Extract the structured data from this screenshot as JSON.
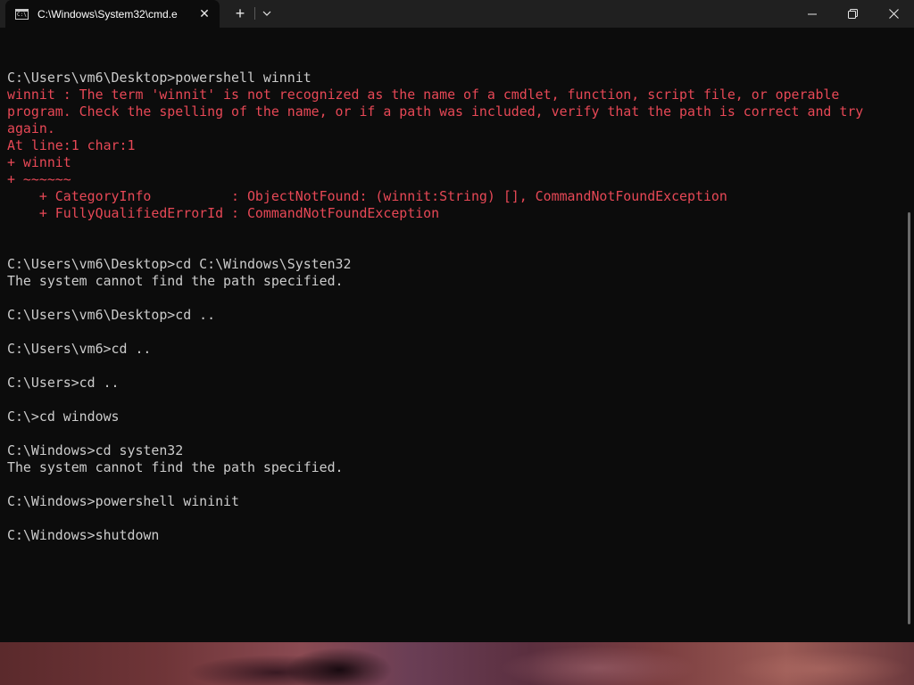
{
  "window": {
    "tab_title": "C:\\Windows\\System32\\cmd.e",
    "tab_icon_label": "C:\\",
    "new_tab_label": "+",
    "close_tab_label": "✕"
  },
  "icons": {
    "tab_icon": "terminal-icon",
    "close_tab": "close-icon",
    "new_tab": "plus-icon",
    "dropdown": "chevron-down-icon",
    "minimize": "minimize-icon",
    "maximize": "restore-icon",
    "close_window": "close-icon"
  },
  "colors": {
    "background": "#0c0c0c",
    "titlebar": "#202020",
    "text": "#cccccc",
    "error": "#e74856"
  },
  "terminal": {
    "lines": [
      {
        "text": "C:\\Users\\vm6\\Desktop>powershell winnit",
        "kind": "normal"
      },
      {
        "text": "winnit : The term 'winnit' is not recognized as the name of a cmdlet, function, script file, or operable",
        "kind": "error"
      },
      {
        "text": "program. Check the spelling of the name, or if a path was included, verify that the path is correct and try",
        "kind": "error"
      },
      {
        "text": "again.",
        "kind": "error"
      },
      {
        "text": "At line:1 char:1",
        "kind": "error"
      },
      {
        "text": "+ winnit",
        "kind": "error"
      },
      {
        "text": "+ ~~~~~~",
        "kind": "error"
      },
      {
        "text": "    + CategoryInfo          : ObjectNotFound: (winnit:String) [], CommandNotFoundException",
        "kind": "error"
      },
      {
        "text": "    + FullyQualifiedErrorId : CommandNotFoundException",
        "kind": "error"
      },
      {
        "text": "",
        "kind": "normal"
      },
      {
        "text": "",
        "kind": "normal"
      },
      {
        "text": "C:\\Users\\vm6\\Desktop>cd C:\\Windows\\Systen32",
        "kind": "normal"
      },
      {
        "text": "The system cannot find the path specified.",
        "kind": "normal"
      },
      {
        "text": "",
        "kind": "normal"
      },
      {
        "text": "C:\\Users\\vm6\\Desktop>cd ..",
        "kind": "normal"
      },
      {
        "text": "",
        "kind": "normal"
      },
      {
        "text": "C:\\Users\\vm6>cd ..",
        "kind": "normal"
      },
      {
        "text": "",
        "kind": "normal"
      },
      {
        "text": "C:\\Users>cd ..",
        "kind": "normal"
      },
      {
        "text": "",
        "kind": "normal"
      },
      {
        "text": "C:\\>cd windows",
        "kind": "normal"
      },
      {
        "text": "",
        "kind": "normal"
      },
      {
        "text": "C:\\Windows>cd systen32",
        "kind": "normal"
      },
      {
        "text": "The system cannot find the path specified.",
        "kind": "normal"
      },
      {
        "text": "",
        "kind": "normal"
      },
      {
        "text": "C:\\Windows>powershell wininit",
        "kind": "normal"
      },
      {
        "text": "",
        "kind": "normal"
      },
      {
        "text": "C:\\Windows>shutdown",
        "kind": "normal"
      }
    ]
  }
}
